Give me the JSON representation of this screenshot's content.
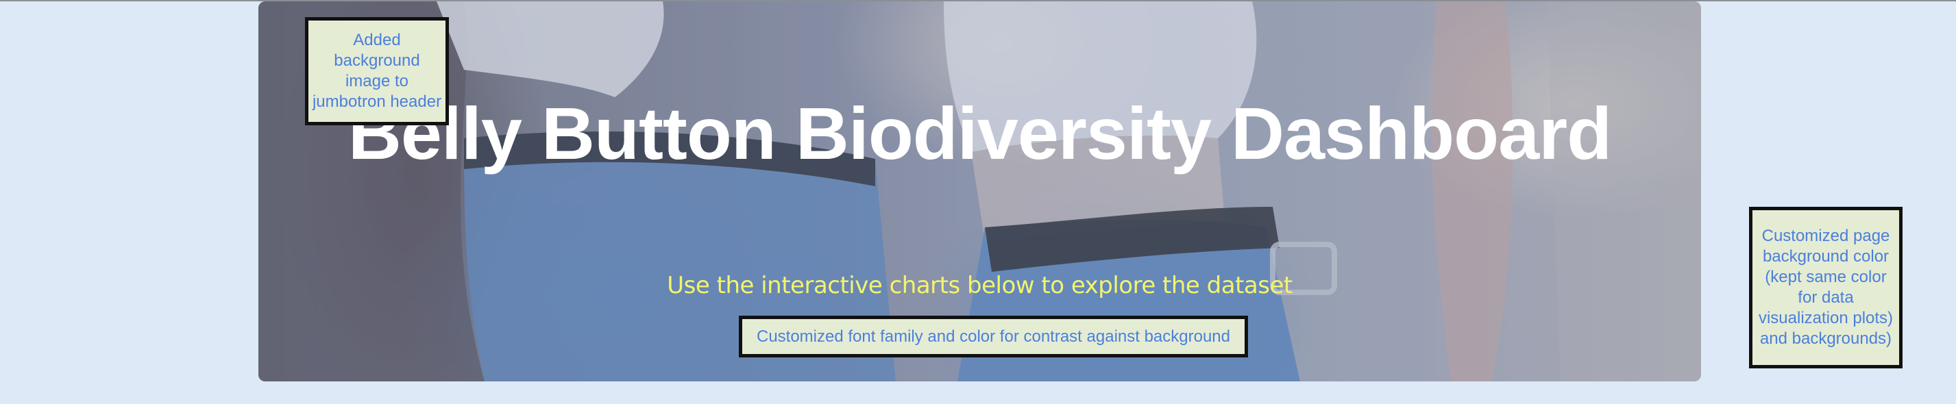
{
  "header": {
    "title": "Belly Button Biodiversity Dashboard",
    "subtitle": "Use the interactive charts below to explore the dataset"
  },
  "annotations": {
    "background_image_note": "Added background image to jumbotron header",
    "font_note": "Customized font family and color for contrast against background",
    "page_background_note": "Customized page background color (kept same color for data visualization plots) and backgrounds)"
  },
  "colors": {
    "page_background": "#dde9f6",
    "title_text": "#ffffff",
    "subtitle_text": "#f4f46a",
    "annotation_text": "#4a7fdc",
    "annotation_background": "#e5ecd4",
    "annotation_border": "#111111"
  }
}
